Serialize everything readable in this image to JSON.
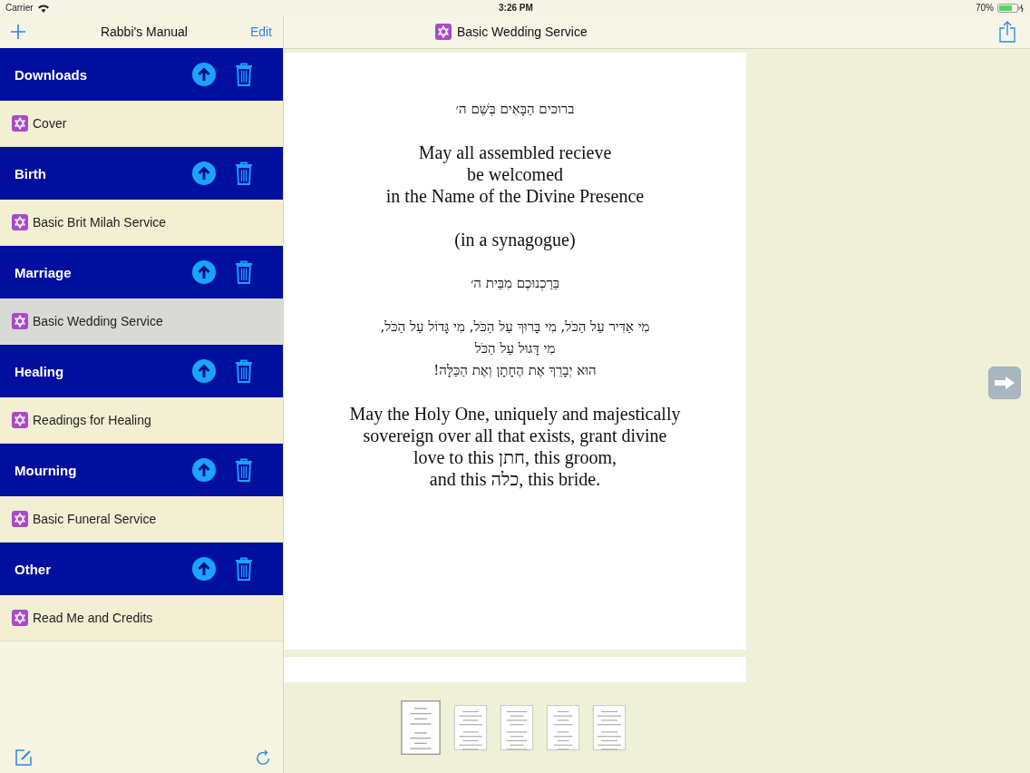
{
  "status_bar": {
    "carrier": "Carrier",
    "time": "3:26 PM",
    "battery": "70%"
  },
  "sidebar": {
    "title": "Rabbi's Manual",
    "edit": "Edit",
    "sections": [
      {
        "title": "Downloads",
        "items": [
          {
            "label": "Cover",
            "selected": false
          }
        ]
      },
      {
        "title": "Birth",
        "items": [
          {
            "label": "Basic Brit Milah Service",
            "selected": false
          }
        ]
      },
      {
        "title": "Marriage",
        "items": [
          {
            "label": "Basic Wedding Service",
            "selected": true
          }
        ]
      },
      {
        "title": "Healing",
        "items": [
          {
            "label": "Readings for Healing",
            "selected": false
          }
        ]
      },
      {
        "title": "Mourning",
        "items": [
          {
            "label": "Basic Funeral Service",
            "selected": false
          }
        ]
      },
      {
        "title": "Other",
        "items": [
          {
            "label": "Read Me and Credits",
            "selected": false
          }
        ]
      }
    ]
  },
  "document": {
    "title": "Basic Wedding Service",
    "paragraphs": [
      {
        "kind": "hebrew",
        "lines": [
          "ברוכים הַבָּאִים בְּשֵׁם ה׳"
        ]
      },
      {
        "kind": "english",
        "lines": [
          "May all assembled recieve",
          "be welcomed",
          "in the Name of the Divine Presence"
        ]
      },
      {
        "kind": "english",
        "lines": [
          "(in a synagogue)"
        ]
      },
      {
        "kind": "hebrew",
        "lines": [
          "בֵּרַכְנוּכֶם מִבֵּית ה׳"
        ]
      },
      {
        "kind": "hebrew",
        "lines": [
          "מִי אַדִּיר עַל הַכֹּל, מִי בָּרוּךְ עַל הַכֹּל, מִי גָּדוֹל עַל הַכֹּל,",
          "מִי דָּגוּל עַל הַכֹּל",
          "הוּא יְבָרֵךְ אֶת הֶחָתָן וְאֶת הַכַּלָּה!"
        ]
      },
      {
        "kind": "english",
        "lines": [
          "May the Holy One, uniquely and majestically",
          "sovereign over all that exists, grant divine",
          "love to this חתן, this groom,",
          "and this כלה, this bride."
        ]
      }
    ],
    "thumbnails": [
      {
        "selected": true
      },
      {
        "selected": false
      },
      {
        "selected": false
      },
      {
        "selected": false
      },
      {
        "selected": false
      }
    ]
  }
}
